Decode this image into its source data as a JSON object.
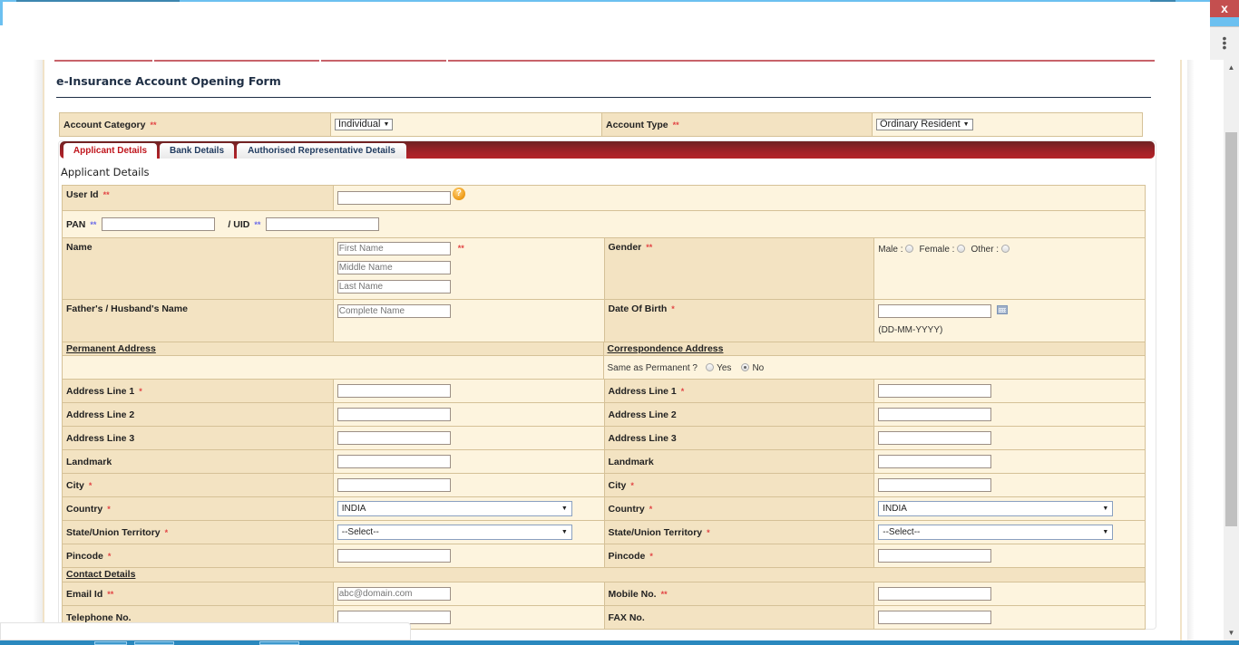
{
  "window": {
    "close_label": "x",
    "menu_icon": "kebab-menu-icon"
  },
  "form": {
    "title": "e-Insurance Account Opening Form",
    "account_category": {
      "label": "Account Category",
      "required": "**",
      "value": "Individual"
    },
    "account_type": {
      "label": "Account Type",
      "required": "**",
      "value": "Ordinary Resident"
    }
  },
  "tabs": [
    {
      "label": "Applicant Details",
      "active": true
    },
    {
      "label": "Bank Details",
      "active": false
    },
    {
      "label": "Authorised Representative Details",
      "active": false
    }
  ],
  "section_title": "Applicant Details",
  "applicant": {
    "user_id": {
      "label": "User Id",
      "required": "**",
      "value": "",
      "help_icon": "?"
    },
    "pan": {
      "label": "PAN",
      "required": "**",
      "value": ""
    },
    "uid": {
      "label": "/ UID",
      "required": "**",
      "value": ""
    },
    "name": {
      "label": "Name",
      "first_placeholder": "First Name",
      "middle_placeholder": "Middle Name",
      "last_placeholder": "Last Name",
      "required": "**"
    },
    "gender": {
      "label": "Gender",
      "required": "**",
      "options": [
        {
          "label": "Male :",
          "checked": false
        },
        {
          "label": "Female :",
          "checked": false
        },
        {
          "label": "Other :",
          "checked": false
        }
      ]
    },
    "father_name": {
      "label": "Father's / Husband's Name",
      "placeholder": "Complete Name"
    },
    "dob": {
      "label": "Date Of Birth",
      "required": "*",
      "value": "",
      "format_hint": "(DD-MM-YYYY)"
    }
  },
  "permanent_address": {
    "heading": "Permanent Address",
    "fields": [
      {
        "label": "Address Line 1",
        "required": "*",
        "value": ""
      },
      {
        "label": "Address Line 2",
        "required": "",
        "value": ""
      },
      {
        "label": "Address Line 3",
        "required": "",
        "value": ""
      },
      {
        "label": "Landmark",
        "required": "",
        "value": ""
      },
      {
        "label": "City",
        "required": "*",
        "value": ""
      }
    ],
    "country": {
      "label": "Country",
      "required": "*",
      "value": "INDIA"
    },
    "state": {
      "label": "State/Union Territory",
      "required": "*",
      "value": "--Select--"
    },
    "pincode": {
      "label": "Pincode",
      "required": "*",
      "value": ""
    }
  },
  "correspondence_address": {
    "heading": "Correspondence Address",
    "same_as_permanent": {
      "label": "Same as Permanent ?",
      "yes": "Yes",
      "no": "No",
      "selected": "No"
    },
    "fields": [
      {
        "label": "Address Line 1",
        "required": "*",
        "value": ""
      },
      {
        "label": "Address Line 2",
        "required": "",
        "value": ""
      },
      {
        "label": "Address Line 3",
        "required": "",
        "value": ""
      },
      {
        "label": "Landmark",
        "required": "",
        "value": ""
      },
      {
        "label": "City",
        "required": "*",
        "value": ""
      }
    ],
    "country": {
      "label": "Country",
      "required": "*",
      "value": "INDIA"
    },
    "state": {
      "label": "State/Union Territory",
      "required": "*",
      "value": "--Select--"
    },
    "pincode": {
      "label": "Pincode",
      "required": "*",
      "value": ""
    }
  },
  "contact": {
    "heading": "Contact Details",
    "email": {
      "label": "Email Id",
      "required": "**",
      "placeholder": "abc@domain.com"
    },
    "mobile": {
      "label": "Mobile No.",
      "required": "**",
      "value": ""
    },
    "telephone": {
      "label": "Telephone No.",
      "value": ""
    },
    "fax": {
      "label": "FAX No.",
      "value": ""
    }
  },
  "colors": {
    "tab_bar": "#a12127",
    "label_bg": "#f3e3c2",
    "value_bg": "#fdf4de",
    "required": "#e24444",
    "title": "#1f2f45"
  }
}
